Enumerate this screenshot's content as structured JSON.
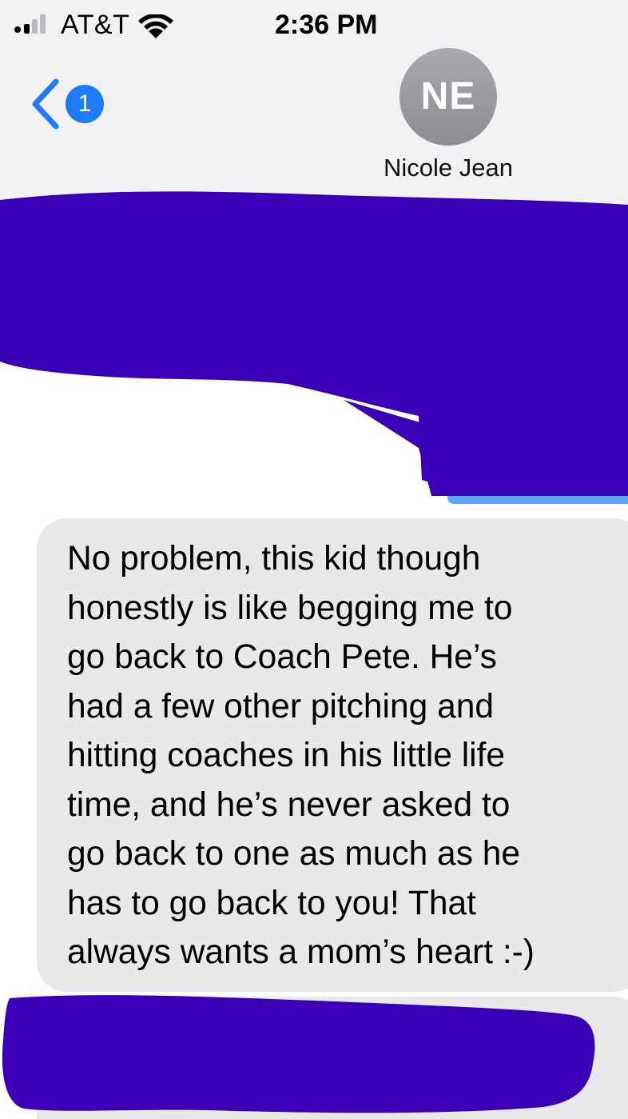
{
  "status_bar": {
    "carrier": "AT&T",
    "time": "2:36 PM",
    "signal_bars": 2
  },
  "nav": {
    "back_badge_count": "1",
    "back_icon": "chevron-left-icon"
  },
  "contact": {
    "initials": "NE",
    "name": "Nicole Jean"
  },
  "messages": [
    {
      "direction": "incoming",
      "text": "No problem, this kid though\nhonestly is like begging me to\ngo back to Coach Pete. He’s\nhad a few other pitching and\nhitting coaches in his little life\ntime, and he’s never asked to\ngo back to one as much as he\nhas to go back to you! That\nalways wants a mom’s heart :-)"
    }
  ],
  "colors": {
    "accent": "#1e7cf6",
    "bubble_incoming": "#e9e9eb",
    "bubble_outgoing": "#5aa7f7",
    "redaction": "#3a00b8",
    "header_bg": "#f2f2f4"
  }
}
